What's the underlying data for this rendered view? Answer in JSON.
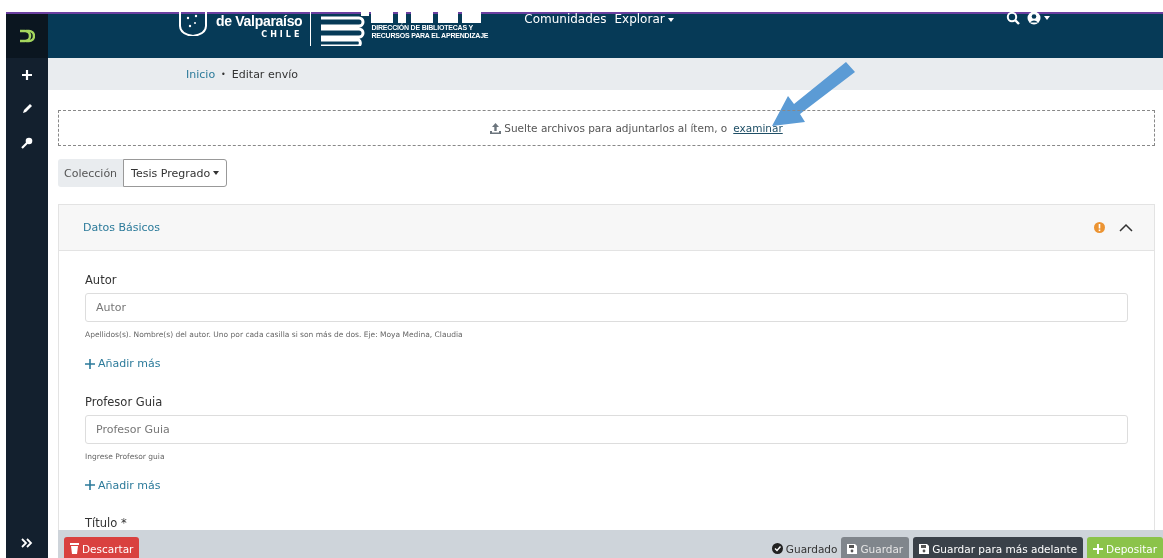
{
  "header": {
    "logo_line": "de Valparaíso",
    "logo_country": "CHILE",
    "library_line_1": "DIRECCIÓN DE BIBLIOTECAS Y",
    "library_line_2": "RECURSOS PARA EL APRENDIZAJE",
    "nav": [
      {
        "label": "Comunidades",
        "dropdown": false
      },
      {
        "label": "Explorar",
        "dropdown": true
      }
    ]
  },
  "sidebar": {
    "items": [
      {
        "kind": "plus"
      },
      {
        "kind": "pencil"
      },
      {
        "kind": "key"
      }
    ]
  },
  "breadcrumb_separator": "•",
  "breadcrumb": [
    {
      "label": "Inicio",
      "link": true
    },
    {
      "label": "Editar envío",
      "link": false
    }
  ],
  "dropzone": {
    "text": "Suelte archivos para adjuntarlos al ítem, o",
    "link": "examinar"
  },
  "collection": {
    "label": "Colección",
    "value": "Tesis Pregrado"
  },
  "section": {
    "title": "Datos Básicos",
    "warning": true,
    "expanded": true,
    "fields": [
      {
        "label": "Autor",
        "placeholder": "Autor",
        "hint": "Apellidos(s). Nombre(s) del autor. Uno por cada casilla si son más de dos. Eje: Moya Medina, Claudia",
        "add": "Añadir más"
      },
      {
        "label": "Profesor Guia",
        "placeholder": "Profesor Guia",
        "hint": "Ingrese Profesor guia",
        "add": "Añadir más"
      },
      {
        "label": "Título *"
      }
    ]
  },
  "footer": {
    "discard": "Descartar",
    "status": "Guardado",
    "buttons": [
      {
        "label": "Guardar",
        "kind": "save",
        "disabled": true
      },
      {
        "label": "Guardar para más adelante",
        "kind": "save",
        "disabled": false
      },
      {
        "label": "Depositar",
        "kind": "deposit",
        "disabled": false
      }
    ]
  }
}
